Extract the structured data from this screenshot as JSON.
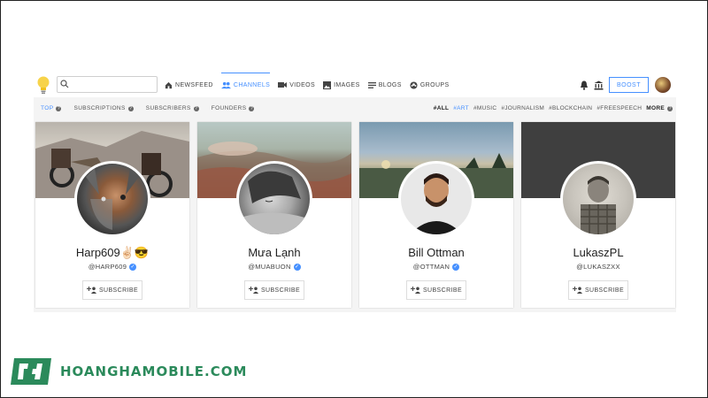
{
  "search": {
    "placeholder": ""
  },
  "nav": [
    {
      "label": "NEWSFEED",
      "icon": "home-icon"
    },
    {
      "label": "CHANNELS",
      "icon": "people-icon",
      "active": true
    },
    {
      "label": "VIDEOS",
      "icon": "video-icon"
    },
    {
      "label": "IMAGES",
      "icon": "image-icon"
    },
    {
      "label": "BLOGS",
      "icon": "blog-icon"
    },
    {
      "label": "GROUPS",
      "icon": "group-icon"
    }
  ],
  "header": {
    "boost_label": "BOOST"
  },
  "subtabs": [
    {
      "label": "TOP",
      "active": true
    },
    {
      "label": "SUBSCRIPTIONS"
    },
    {
      "label": "SUBSCRIBERS"
    },
    {
      "label": "FOUNDERS"
    }
  ],
  "hashtags": [
    {
      "label": "#ALL",
      "bold": true
    },
    {
      "label": "#ART",
      "active": true
    },
    {
      "label": "#MUSIC"
    },
    {
      "label": "#JOURNALISM"
    },
    {
      "label": "#BLOCKCHAIN"
    },
    {
      "label": "#FREESPEECH"
    },
    {
      "label": "MORE",
      "bold": true
    }
  ],
  "channels": [
    {
      "name": "Harp609✌🏻😎",
      "handle": "@HARP609",
      "subscribe_label": "SUBSCRIBE"
    },
    {
      "name": "Mưa Lạnh",
      "handle": "@MUABUON",
      "subscribe_label": "SUBSCRIBE"
    },
    {
      "name": "Bill Ottman",
      "handle": "@OTTMAN",
      "subscribe_label": "SUBSCRIBE"
    },
    {
      "name": "LukaszPL",
      "handle": "@LUKASZXX",
      "subscribe_label": "SUBSCRIBE"
    }
  ],
  "watermark": {
    "text": "HOANGHAMOBILE.COM"
  },
  "colors": {
    "accent": "#4690ff",
    "watermark": "#2b8a5b"
  }
}
